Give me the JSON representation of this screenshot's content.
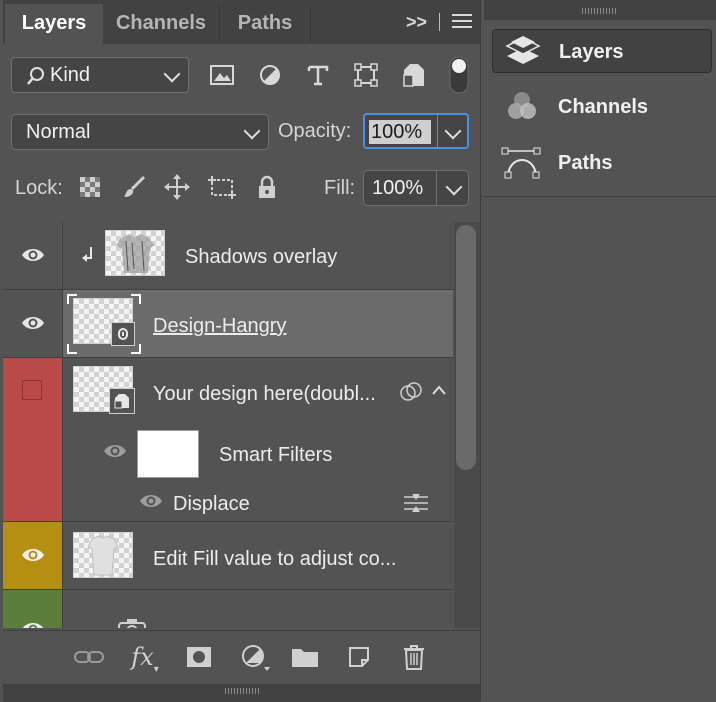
{
  "tabs": [
    "Layers",
    "Channels",
    "Paths"
  ],
  "tabbar_icons": {
    "collapse": ">>",
    "menu": "menu-icon"
  },
  "filter": {
    "kind_label": "Kind",
    "icons": [
      "image-filter-icon",
      "adjustment-filter-icon",
      "type-filter-icon",
      "shape-filter-icon",
      "smart-object-filter-icon"
    ]
  },
  "blend": {
    "mode": "Normal",
    "opacity_label": "Opacity:",
    "opacity_value": "100%"
  },
  "lock": {
    "label": "Lock:",
    "fill_label": "Fill:",
    "fill_value": "100%"
  },
  "layers": [
    {
      "name": "Shadows overlay",
      "visible": true,
      "clipped": true
    },
    {
      "name": "Design-Hangry",
      "visible": true,
      "selected": true,
      "linked": true
    },
    {
      "name": "Your design here(doubl...",
      "visible": false,
      "color": "#b94a48",
      "smart_object": true
    },
    {
      "name": "Smart Filters",
      "visible": true,
      "sublayer": true
    },
    {
      "name": "Displace",
      "visible": true,
      "filter": true
    },
    {
      "name": "Edit Fill value to adjust co...",
      "visible": true,
      "color": "#b58f12"
    },
    {
      "name": "",
      "visible": true,
      "color": "#5b7f3b"
    }
  ],
  "footer_icons": [
    "link-layers-icon",
    "fx-icon",
    "add-mask-icon",
    "new-adjustment-icon",
    "new-group-icon",
    "new-layer-icon",
    "delete-layer-icon"
  ],
  "footer_fx_label": "fx",
  "side_panel": {
    "items": [
      "Layers",
      "Channels",
      "Paths"
    ]
  }
}
